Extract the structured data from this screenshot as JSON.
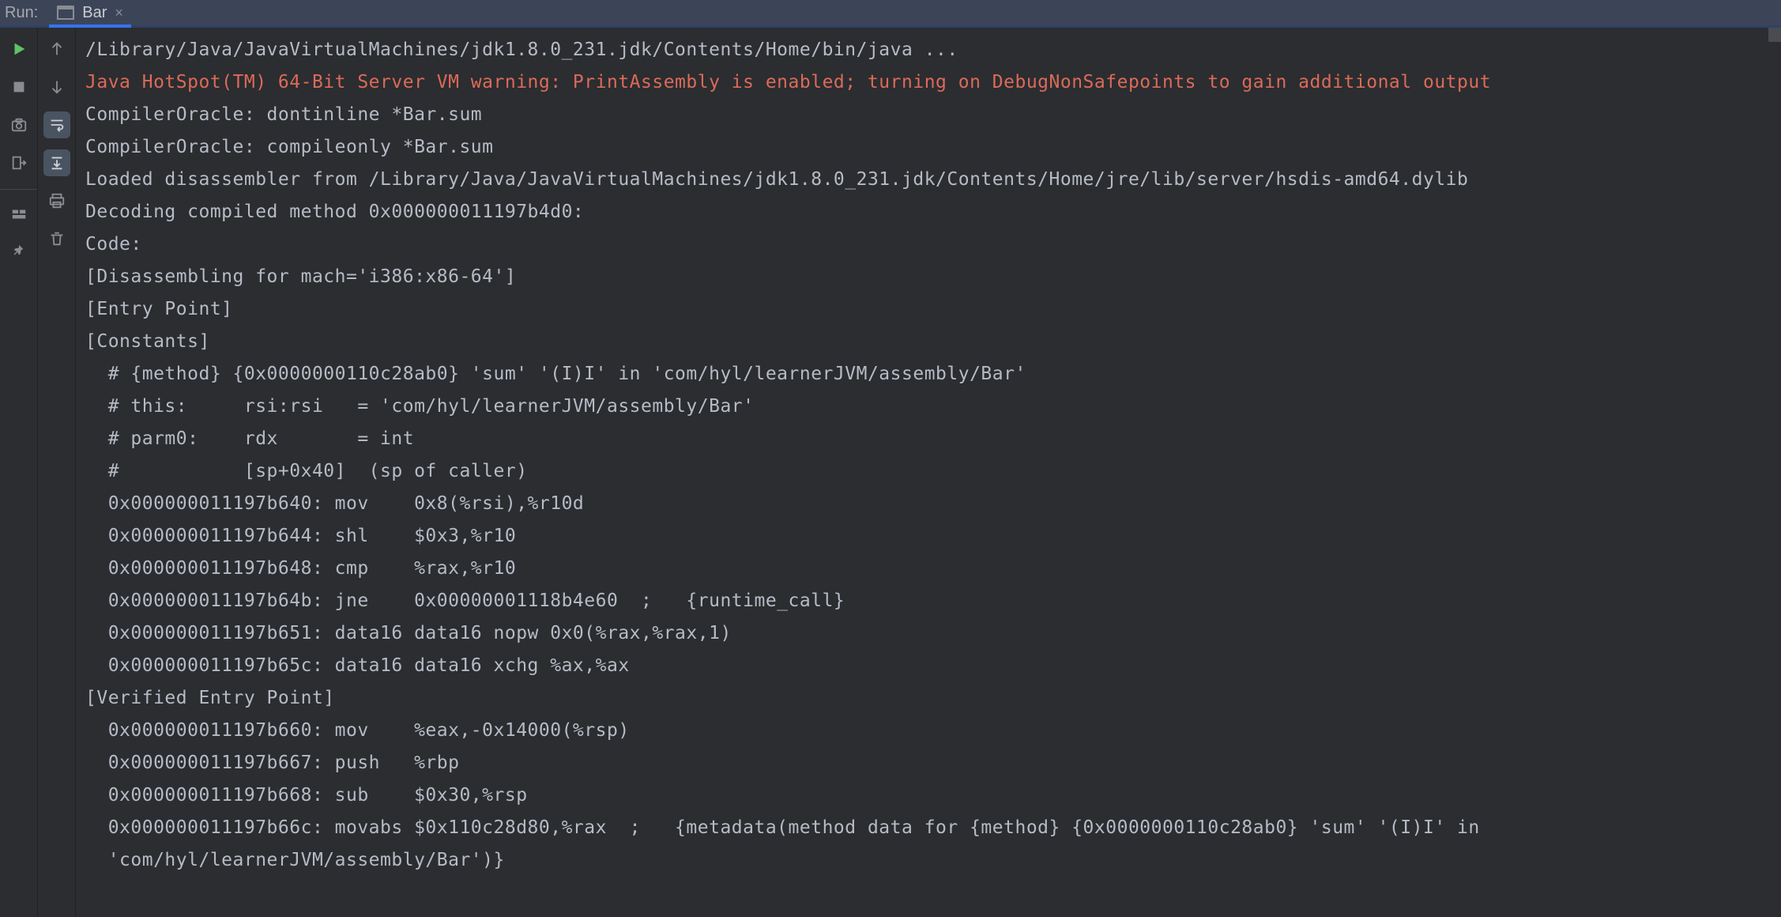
{
  "header": {
    "run_label": "Run:",
    "tab_label": "Bar",
    "tab_close": "×"
  },
  "console": {
    "lines": [
      {
        "cls": "",
        "text": "/Library/Java/JavaVirtualMachines/jdk1.8.0_231.jdk/Contents/Home/bin/java ..."
      },
      {
        "cls": "warn",
        "text": "Java HotSpot(TM) 64-Bit Server VM warning: PrintAssembly is enabled; turning on DebugNonSafepoints to gain additional output"
      },
      {
        "cls": "",
        "text": "CompilerOracle: dontinline *Bar.sum"
      },
      {
        "cls": "",
        "text": "CompilerOracle: compileonly *Bar.sum"
      },
      {
        "cls": "",
        "text": "Loaded disassembler from /Library/Java/JavaVirtualMachines/jdk1.8.0_231.jdk/Contents/Home/jre/lib/server/hsdis-amd64.dylib"
      },
      {
        "cls": "",
        "text": "Decoding compiled method 0x000000011197b4d0:"
      },
      {
        "cls": "",
        "text": "Code:"
      },
      {
        "cls": "",
        "text": "[Disassembling for mach='i386:x86-64']"
      },
      {
        "cls": "",
        "text": "[Entry Point]"
      },
      {
        "cls": "",
        "text": "[Constants]"
      },
      {
        "cls": "",
        "text": "  # {method} {0x0000000110c28ab0} 'sum' '(I)I' in 'com/hyl/learnerJVM/assembly/Bar'"
      },
      {
        "cls": "",
        "text": "  # this:     rsi:rsi   = 'com/hyl/learnerJVM/assembly/Bar'"
      },
      {
        "cls": "",
        "text": "  # parm0:    rdx       = int"
      },
      {
        "cls": "",
        "text": "  #           [sp+0x40]  (sp of caller)"
      },
      {
        "cls": "",
        "text": "  0x000000011197b640: mov    0x8(%rsi),%r10d"
      },
      {
        "cls": "",
        "text": "  0x000000011197b644: shl    $0x3,%r10"
      },
      {
        "cls": "",
        "text": "  0x000000011197b648: cmp    %rax,%r10"
      },
      {
        "cls": "",
        "text": "  0x000000011197b64b: jne    0x00000001118b4e60  ;   {runtime_call}"
      },
      {
        "cls": "",
        "text": "  0x000000011197b651: data16 data16 nopw 0x0(%rax,%rax,1)"
      },
      {
        "cls": "",
        "text": "  0x000000011197b65c: data16 data16 xchg %ax,%ax"
      },
      {
        "cls": "",
        "text": "[Verified Entry Point]"
      },
      {
        "cls": "",
        "text": "  0x000000011197b660: mov    %eax,-0x14000(%rsp)"
      },
      {
        "cls": "",
        "text": "  0x000000011197b667: push   %rbp"
      },
      {
        "cls": "",
        "text": "  0x000000011197b668: sub    $0x30,%rsp"
      },
      {
        "cls": "",
        "text": "  0x000000011197b66c: movabs $0x110c28d80,%rax  ;   {metadata(method data for {method} {0x0000000110c28ab0} 'sum' '(I)I' in"
      },
      {
        "cls": "",
        "text": "  'com/hyl/learnerJVM/assembly/Bar')}"
      }
    ]
  }
}
